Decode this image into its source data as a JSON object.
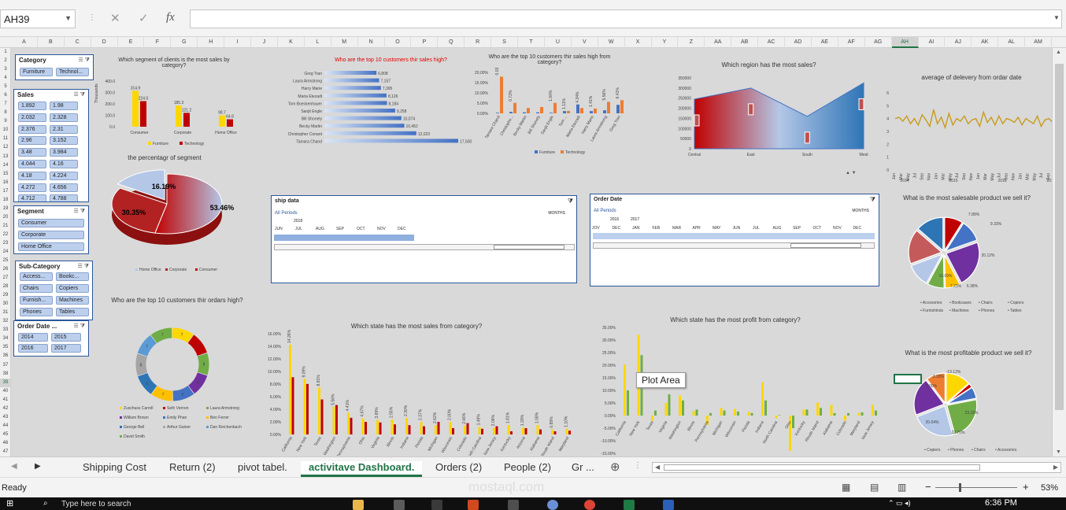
{
  "formula_bar": {
    "name_box": "AH39",
    "fx": "fx",
    "cancel": "✕",
    "confirm": "✓"
  },
  "columns": [
    "A",
    "B",
    "C",
    "D",
    "E",
    "F",
    "G",
    "H",
    "I",
    "J",
    "K",
    "L",
    "M",
    "N",
    "O",
    "P",
    "Q",
    "R",
    "S",
    "T",
    "U",
    "V",
    "W",
    "X",
    "Y",
    "Z",
    "AA",
    "AB",
    "AC",
    "AD",
    "AE",
    "AF",
    "AG",
    "AH",
    "AI",
    "AJ",
    "AK",
    "AL",
    "AM"
  ],
  "rows": [
    "1",
    "2",
    "3",
    "4",
    "5",
    "6",
    "7",
    "8",
    "9",
    "10",
    "11",
    "12",
    "13",
    "14",
    "15",
    "16",
    "17",
    "18",
    "19",
    "20",
    "21",
    "22",
    "23",
    "24",
    "25",
    "26",
    "27",
    "28",
    "29",
    "30",
    "31",
    "32",
    "33",
    "34",
    "35",
    "36",
    "37",
    "38",
    "39",
    "40",
    "41",
    "42",
    "43",
    "44",
    "45",
    "46",
    "47"
  ],
  "slicers": {
    "category": {
      "title": "Category",
      "items": [
        "Furniture",
        "Technol..."
      ]
    },
    "sales": {
      "title": "Sales",
      "items": [
        "1.892",
        "1.98",
        "2.032",
        "2.328",
        "2.376",
        "2.31",
        "2.96",
        "3.152",
        "3.48",
        "3.984",
        "4.044",
        "4.16",
        "4.18",
        "4.224",
        "4.272",
        "4.656",
        "4.712",
        "4.788"
      ]
    },
    "segment": {
      "title": "Segment",
      "items": [
        "Consumer",
        "Corporate",
        "Home Office"
      ]
    },
    "subcategory": {
      "title": "Sub-Category",
      "items": [
        "Access...",
        "Bookc...",
        "Chairs",
        "Copiers",
        "Furnish...",
        "Machines",
        "Phones",
        "Tables"
      ]
    },
    "orderdate": {
      "title": "Order Date ...",
      "items": [
        "2014",
        "2015",
        "2016",
        "2017"
      ]
    }
  },
  "charts": {
    "segment_sales": {
      "title": "Which segment of clients is the most sales by category?",
      "ylabel": "Thousands",
      "yticks": [
        "400.0",
        "300.0",
        "200.0",
        "100.0",
        "0.0"
      ],
      "categories": [
        "Consumer",
        "Corporate",
        "Home Office"
      ],
      "series": [
        {
          "name": "Furniture",
          "values": [
            314.9,
            185.3,
            98.7
          ]
        },
        {
          "name": "Technology",
          "values": [
            224.0,
            121.2,
            64.8
          ]
        }
      ],
      "labels": [
        [
          "314.9",
          "224.0"
        ],
        [
          "185.3",
          "121.2"
        ],
        [
          "98.7",
          "64.8"
        ]
      ]
    },
    "segment_pct": {
      "title": "the percentagr of segment",
      "slices": [
        {
          "name": "Consumer",
          "value": 53.46,
          "label": "53.46%"
        },
        {
          "name": "Corporate",
          "value": 30.35,
          "label": "30.35%"
        },
        {
          "name": "Home Office",
          "value": 16.19,
          "label": "16.19%"
        }
      ]
    },
    "top10_sales": {
      "title": "Who are the top 10 customers thir sales high?",
      "names": [
        "Greg Tran",
        "Laura Armstrong",
        "Harry Marie",
        "Maria Etezadi",
        "Tom Boeckenhauer",
        "Sanjit Engle",
        "Bill Shonely",
        "Becky Martin",
        "Christopher Conant",
        "Tamara Chand"
      ],
      "values": [
        6808,
        7157,
        7395,
        8126,
        8184,
        9258,
        10074,
        10452,
        12023,
        17500
      ],
      "labels": [
        "6,808",
        "7,157",
        "7,395",
        "8,126",
        "8,184",
        "9,258",
        "10,074",
        "10,452",
        "12,023",
        "17,500"
      ]
    },
    "top10_cat": {
      "title": "Who are the top 10 customers thir sales high from category?",
      "yticks": [
        "20.00%",
        "15.00%",
        "10.00%",
        "5.00%",
        "0.00%"
      ],
      "names": [
        "Tamara Chand",
        "Christophe...",
        "Becky Martin",
        "Bill Shonely",
        "Sanjit Engle",
        "Tom ...",
        "Maria Etezadi",
        "Harry Marie",
        "Laura Armstrong",
        "Greg Tran"
      ],
      "furniture": [
        0.3,
        0.72,
        0.5,
        0.5,
        0.3,
        1.1,
        4.34,
        1.1,
        1.5,
        4.15
      ],
      "technology": [
        17.9,
        5.1,
        2.6,
        3.1,
        5.1,
        1.2,
        2.6,
        2.3,
        5.6,
        6.41
      ],
      "labels": [
        "0.03%",
        "0.72%",
        "",
        "",
        "1.00%",
        "1.11%",
        "4.34%",
        "1.41%",
        "5.56%",
        "6.41%"
      ],
      "legend": [
        "Furniture",
        "Technology"
      ]
    },
    "region": {
      "title": "Which region has the most sales?",
      "yticks": [
        "350000",
        "300000",
        "250000",
        "200000",
        "150000",
        "100000",
        "50000",
        "0"
      ],
      "categories": [
        "Central",
        "East",
        "South",
        "West"
      ],
      "values": [
        245000,
        300000,
        160000,
        325000
      ]
    },
    "delivery": {
      "title": "average of delevery from ordar date",
      "yticks": [
        "6",
        "5",
        "4",
        "3",
        "2",
        "1",
        "0"
      ],
      "years": [
        "2014",
        "2015",
        "2016",
        "2017"
      ],
      "months": [
        "Jan",
        "Mar",
        "May",
        "Jul",
        "Sep",
        "Nov"
      ],
      "values": [
        4,
        4.1,
        3.8,
        4.2,
        3.6,
        4.0,
        3.5,
        4.3,
        3.9,
        3.4,
        4.7,
        3.6,
        4.1,
        3.3,
        4.4,
        3.5,
        4.0,
        3.8,
        4.2,
        3.6,
        3.9,
        4.0,
        3.4,
        4.5,
        3.7,
        4.1,
        3.5,
        4.2,
        3.6,
        4.0,
        3.9,
        3.7,
        4.1,
        3.5,
        4.0,
        3.8,
        3.6,
        4.2,
        3.4,
        3.9,
        4.0,
        3.7,
        3.2
      ]
    },
    "ship_timeline": {
      "title": "ship data",
      "period": "All Periods",
      "unit": "MONTHS",
      "year": "2018",
      "months": [
        "JUN",
        "JUL",
        "AUG",
        "SEP",
        "OCT",
        "NOV",
        "DEC"
      ]
    },
    "order_timeline": {
      "title": "Order Date",
      "period": "All Periods",
      "unit": "MONTHS",
      "years": [
        "2016",
        "2017"
      ],
      "months": [
        "JOV",
        "DEC",
        "JAN",
        "FEB",
        "MAR",
        "APR",
        "MAY",
        "JUN",
        "JUL",
        "AUG",
        "SEP",
        "OCT",
        "NOV",
        "DEC"
      ]
    },
    "top10_orders": {
      "title": "Who are the top 10 customers thir ordars high?",
      "ring": [
        "7",
        "8",
        "8",
        "8",
        "9",
        "7",
        "6",
        "8",
        "7",
        "7"
      ],
      "legend": [
        "Zuschuss Carroll",
        "Seth Vernon",
        "Laura Armstrong",
        "William Brown",
        "Emily Phan",
        "Ben Ferrer",
        "George Bell",
        "Arthur Gainer",
        "Dan Reichenbach",
        "David Smith"
      ]
    },
    "state_sales": {
      "title": "Which state has the most sales from category?",
      "yticks": [
        "16.00%",
        "14.00%",
        "12.00%",
        "10.00%",
        "8.00%",
        "6.00%",
        "4.00%",
        "2.00%",
        "0.00%"
      ],
      "states": [
        "California",
        "New York",
        "Texas",
        "Washington",
        "Pennsylvania",
        "Ohio",
        "Virginia",
        "Illinois",
        "Indiana",
        "Florida",
        "Michigan",
        "Wisconsin",
        "Colorado",
        "North Carolina",
        "New Jersey",
        "Kentucky",
        "Arizona",
        "Alabama",
        "Rhode Island",
        "Maryland"
      ],
      "furniture": [
        14.26,
        8.81,
        7.44,
        4.41,
        3.47,
        2.55,
        2.3,
        2.37,
        2.62,
        2.0,
        1.5,
        2.0,
        1.4,
        1.2,
        1.1,
        1.5,
        1.1,
        1.5,
        0.8,
        0.9
      ],
      "technology": [
        9.09,
        8.02,
        5.56,
        4.67,
        2.65,
        2.0,
        1.9,
        1.6,
        1.47,
        1.3,
        2.0,
        1.0,
        1.8,
        0.9,
        1.3,
        0.5,
        1.0,
        0.8,
        0.5,
        0.6
      ],
      "labels": [
        "14.26%",
        "9.09%",
        "8.81%",
        "5.56%",
        "4.41%",
        "4.67%",
        "3.69%",
        "2.55%",
        "2.30%",
        "2.37%",
        "2.62%",
        "2.00%",
        "2.06%",
        "1.49%",
        "2.06%",
        "1.81%",
        "1.20%",
        "1.08%",
        "0.89%",
        "1.10%",
        "0.90%"
      ]
    },
    "state_profit": {
      "title": "Which state has the most profit from category?",
      "yticks": [
        "35.00%",
        "30.00%",
        "25.00%",
        "20.00%",
        "15.00%",
        "10.00%",
        "5.00%",
        "0.00%",
        "-5.00%",
        "-10.00%",
        "-15.00%"
      ],
      "states": [
        "California",
        "New York",
        "Texas",
        "Virginia",
        "Washington",
        "Illinois",
        "Pennsylvania",
        "Michigan",
        "Wisconsin",
        "Florida",
        "Indiana",
        "North Carolina",
        "Ohio",
        "Kentucky",
        "Rhode Island",
        "Alabama",
        "Colorado",
        "Maryland",
        "New Jersey"
      ],
      "a": [
        20.3,
        32.04,
        -2.1,
        5.0,
        8.0,
        1.8,
        -3.71,
        3.0,
        2.6,
        1.5,
        13.2,
        -1.0,
        -14.0,
        2.4,
        5.07,
        4.22,
        -2.0,
        1.0,
        4.28
      ],
      "b": [
        10.0,
        24.0,
        2.0,
        8.4,
        6.0,
        2.4,
        1.0,
        2.0,
        1.6,
        1.0,
        6.0,
        0.18,
        -5.0,
        2.4,
        3.0,
        1.0,
        1.0,
        1.3,
        2.0
      ],
      "tooltip": "Plot Area"
    },
    "salesable": {
      "title": "What is the most salesable product we sell it?",
      "labels": [
        "7.89%",
        "9.33%",
        "20.12%",
        "6.38%",
        "7.23%",
        "10.09%"
      ],
      "legend": [
        "Accesories",
        "Bookcases",
        "Chairs",
        "Copiers",
        "Furnishings",
        "Machines",
        "Phones",
        "Tables"
      ]
    },
    "profitable": {
      "title": "What is the most profitable product we sell it?",
      "labels": [
        "-13.12%",
        "-2.18%",
        "0.00%",
        "23.15%",
        "22.70%",
        "20.04%"
      ],
      "legend": [
        "Copiers",
        "Phones",
        "Chairs",
        "Accesories"
      ]
    }
  },
  "tabs": {
    "items": [
      "Shipping Cost",
      "Return (2)",
      "pivot tabel.",
      "activitave Dashboard.",
      "Orders (2)",
      "People (2)",
      "Gr ..."
    ],
    "active": "activitave Dashboard."
  },
  "status": {
    "ready": "Ready",
    "zoom": "53%",
    "minus": "−",
    "plus": "+"
  },
  "taskbar": {
    "search": "Type here to search",
    "time": "6:36 PM"
  },
  "watermark": "mostaql.com",
  "colors": {
    "red": "#c00000",
    "blue": "#4472c4",
    "yellow": "#ffd700",
    "gold": "#c99a1c",
    "excel_green": "#217346"
  }
}
